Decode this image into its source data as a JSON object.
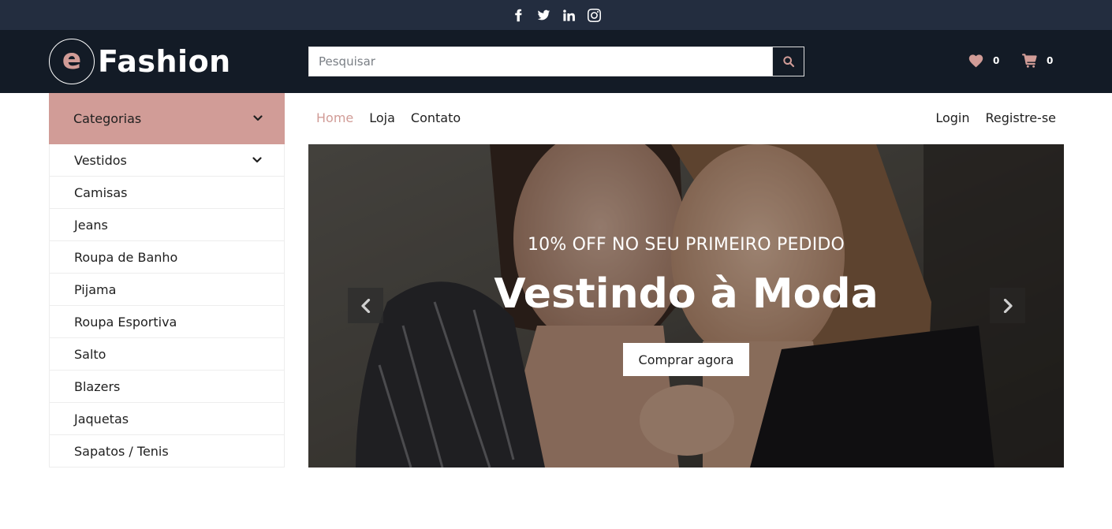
{
  "topbar": {
    "icons": [
      "facebook-icon",
      "twitter-icon",
      "linkedin-icon",
      "instagram-icon"
    ]
  },
  "header": {
    "logo_letter": "e",
    "logo_text": "Fashion",
    "search": {
      "placeholder": "Pesquisar",
      "value": ""
    },
    "wishlist_count": "0",
    "cart_count": "0"
  },
  "sidebar": {
    "title": "Categorias",
    "items": [
      {
        "label": "Vestidos",
        "has_submenu": true
      },
      {
        "label": "Camisas"
      },
      {
        "label": "Jeans"
      },
      {
        "label": "Roupa de Banho"
      },
      {
        "label": "Pijama"
      },
      {
        "label": "Roupa Esportiva"
      },
      {
        "label": "Salto"
      },
      {
        "label": "Blazers"
      },
      {
        "label": "Jaquetas"
      },
      {
        "label": "Sapatos / Tenis"
      }
    ]
  },
  "nav": {
    "left": [
      {
        "label": "Home",
        "active": true
      },
      {
        "label": "Loja"
      },
      {
        "label": "Contato"
      }
    ],
    "right": [
      {
        "label": "Login"
      },
      {
        "label": "Registre-se"
      }
    ]
  },
  "carousel": {
    "subtitle": "10% OFF NO SEU PRIMEIRO PEDIDO",
    "title": "Vestindo à Moda",
    "button_label": "Comprar agora"
  },
  "colors": {
    "accent": "#d19c97",
    "dark": "#131b26",
    "topbar": "#232d3f"
  }
}
